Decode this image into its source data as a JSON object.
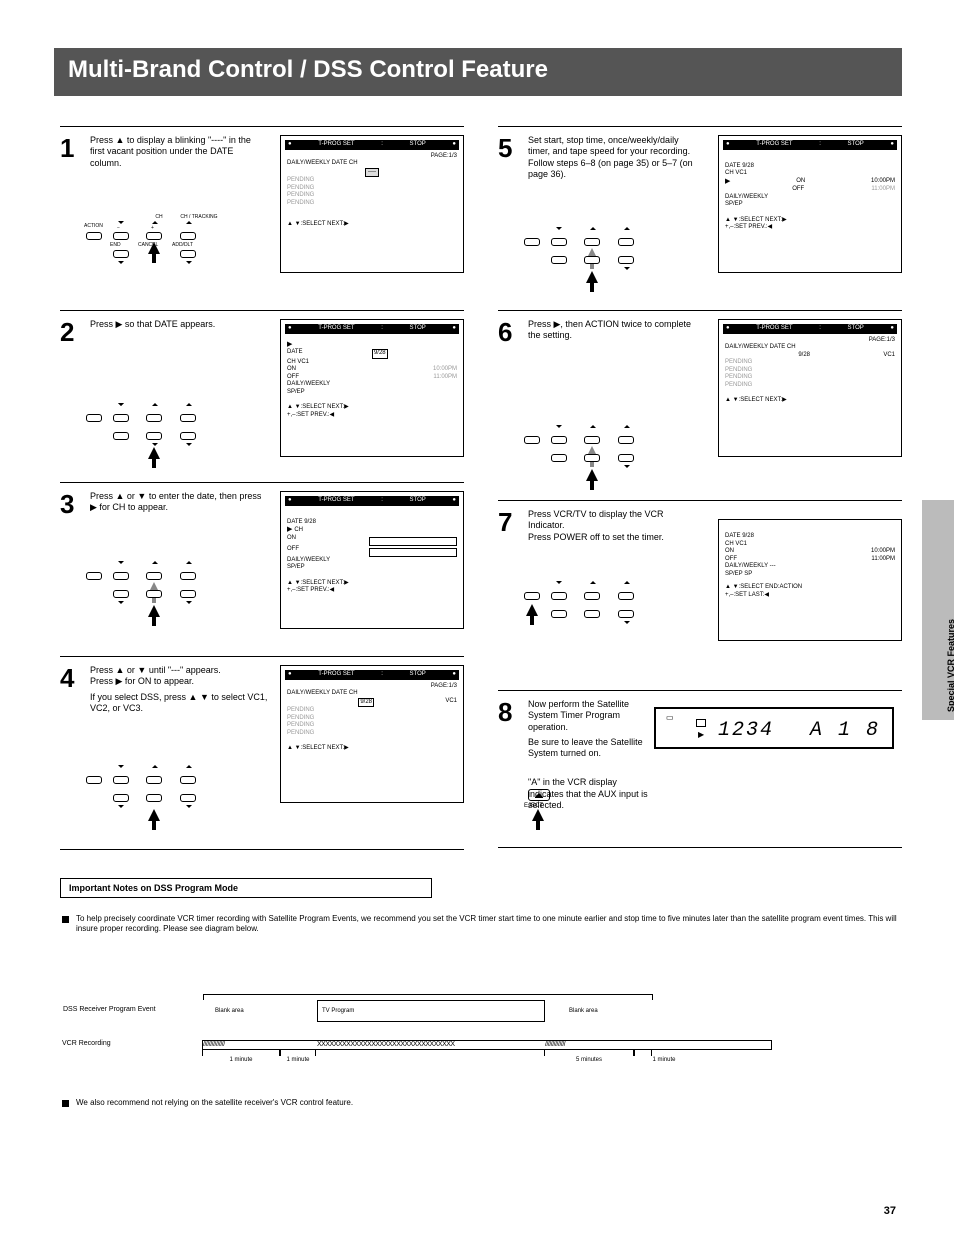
{
  "page_title": "Multi-Brand Control / DSS Control Feature",
  "side_tab": "Special VCR Features",
  "page_number": "37",
  "screens": {
    "timer_head": {
      "t_left": "T-PROG SET",
      "t_right": "STOP",
      "pg": "PAGE:1/3"
    },
    "timer_body_top": "DAILY/WEEKLY   DATE   CH",
    "timer_pending": "PENDING",
    "prog_row": {
      "date": "9/28",
      "ch": "VC1"
    },
    "select_hint": "▲ ▼:SELECT   NEXT:▶",
    "date_screen": {
      "t_left": "T-PROG SET",
      "t_right": "STOP",
      "row_date": "DATE",
      "input_box": "9/28",
      "row_ch": "CH       VC1",
      "on_lbl": "ON",
      "on_time": "10:00PM",
      "off_lbl": "OFF",
      "off_time": "11:00PM",
      "line_daily": "DAILY/WEEKLY",
      "line_speed": "SP/EP",
      "hint1": "▲ ▼:SELECT   NEXT:▶",
      "hint2": "+,–:SET    PREV.:◀"
    },
    "ch_only": {
      "t_left": "T-PROG SET",
      "t_right": "STOP",
      "row1": "DATE     9/28",
      "row2": "CH",
      "on_lbl": "ON",
      "off_lbl": "OFF",
      "line_daily": "DAILY/WEEKLY",
      "line_speed": "SP/EP",
      "hint1": "▲ ▼:SELECT   NEXT:▶",
      "hint2": "+,–:SET    PREV.:◀"
    },
    "start_time": {
      "t_left": "T-PROG SET",
      "t_right": "STOP",
      "row1": "DATE     9/28",
      "row2": "CH       VC1",
      "on_lbl": "ON",
      "on_time": "10:00PM",
      "off_lbl": "OFF",
      "off_time": "11:00PM",
      "line_daily": "DAILY/WEEKLY",
      "line_speed": "SP/EP",
      "hint1": "▲ ▼:SELECT   NEXT:▶",
      "hint2": "+,–:SET    PREV.:◀"
    },
    "final": {
      "row1": "DATE     9/28",
      "row2": "CH       VC1",
      "on_lbl": "ON",
      "on_time": "10:00PM",
      "off_lbl": "OFF",
      "off_time": "11:00PM",
      "line_daily": "DAILY/WEEKLY   ---",
      "line_speed": "SP/EP          SP",
      "hint1": "▲ ▼:SELECT   END:ACTION",
      "hint2": "+,–:SET    LAST:◀"
    }
  },
  "cluster_labels": {
    "c1": "ACTION",
    "c2": "END",
    "c3": "CANCEL",
    "c4": "ADD/DLT",
    "arrow_l": "CH",
    "arrow_r": "CH / TRACKING"
  },
  "steps_left": {
    "s1": {
      "num": "1",
      "text": "Press ▲ to display a blinking \"----\" in the first vacant position under the DATE column."
    },
    "s2": {
      "num": "2",
      "text": "Press ▶ so that DATE appears."
    },
    "s3": {
      "num": "3",
      "text": "Press ▲ or ▼ to enter the date, then press ▶ for CH to appear."
    },
    "s4": {
      "num": "4",
      "text_a": "Press ▲ or ▼ until \"---\" appears.",
      "text_b": "Press ▶ for ON to appear.",
      "note": "If you select DSS, press ▲ ▼ to select VC1, VC2, or VC3."
    }
  },
  "steps_right": {
    "s5": {
      "num": "5",
      "text": "Set start, stop time, once/weekly/daily timer, and tape speed for your recording. Follow steps 6–8 (on page 35) or 5–7 (on page 36)."
    },
    "s6": {
      "num": "6",
      "text": "Press ▶, then ACTION twice to complete the setting."
    },
    "s7": {
      "num": "7",
      "text_a": "Press VCR/TV to display the VCR Indicator.",
      "text_b": "Press POWER off to set the timer."
    },
    "s8": {
      "num": "8",
      "text_a": "Now perform the Satellite System Timer Program operation.",
      "text_b": "Be sure to leave the Satellite System turned on.",
      "note": "\"A\" in the VCR display indicates that the AUX input is selected."
    }
  },
  "vcr_display": {
    "tape_icon": "⏵",
    "time": "1234",
    "aux": "A 1 8",
    "eject_label": "EJECT"
  },
  "notes": {
    "title": "Important Notes on DSS Program Mode",
    "n1": "To help precisely coordinate VCR timer recording with Satellite Program Events, we recommend you set the VCR timer start time to one minute earlier and stop time to five minutes later than the satellite program event times. This will insure proper recording. Please see diagram below.",
    "n2": "We also recommend not relying on the satellite receiver's VCR control feature."
  },
  "timeline": {
    "dss_label": "DSS Receiver Program Event",
    "prog_label": "TV Program",
    "blank_label": "Blank area",
    "vcr_label": "VCR Recording",
    "seg1": "1 minute",
    "seg2": "5 minutes"
  }
}
